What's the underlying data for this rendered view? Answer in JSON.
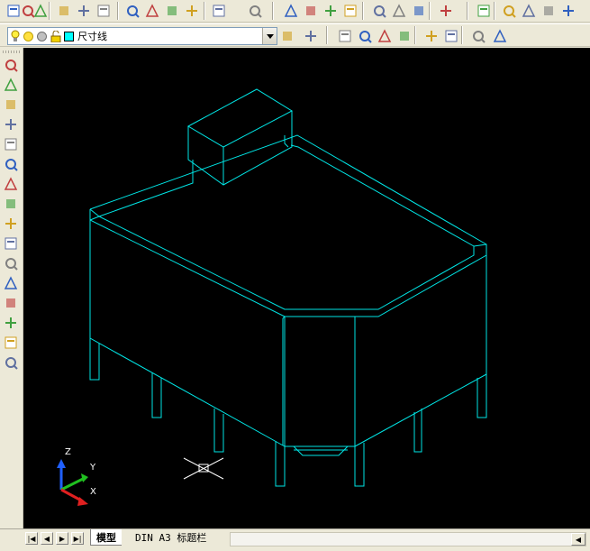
{
  "toolbar": {
    "buttons_row1": [
      {
        "name": "new-icon"
      },
      {
        "name": "open-icon"
      },
      {
        "name": "save-icon"
      },
      {
        "name": "plot-icon"
      },
      {
        "name": "plot-preview-icon"
      },
      {
        "name": "publish-icon"
      },
      {
        "name": "cut-icon"
      },
      {
        "name": "copy-icon"
      },
      {
        "name": "paste-icon"
      },
      {
        "name": "match-properties-icon"
      },
      {
        "name": "undo-icon"
      },
      {
        "name": "redo-icon"
      },
      {
        "name": "pan-icon"
      },
      {
        "name": "zoom-realtime-icon"
      },
      {
        "name": "zoom-window-icon"
      },
      {
        "name": "zoom-previous-icon"
      },
      {
        "name": "properties-icon"
      },
      {
        "name": "design-center-icon"
      },
      {
        "name": "tool-palettes-icon"
      },
      {
        "name": "help-icon"
      },
      {
        "name": "named-views-icon"
      },
      {
        "name": "top-view-icon"
      },
      {
        "name": "front-view-icon"
      },
      {
        "name": "left-view-icon"
      },
      {
        "name": "iso-view-icon"
      }
    ],
    "buttons_row2": [
      {
        "name": "layer-manager-icon"
      },
      {
        "name": "layer-previous-icon"
      },
      {
        "name": "zoom-window-icon"
      },
      {
        "name": "zoom-dynamic-icon"
      },
      {
        "name": "zoom-scale-icon"
      },
      {
        "name": "zoom-center-icon"
      },
      {
        "name": "zoom-in-icon"
      },
      {
        "name": "zoom-out-icon"
      },
      {
        "name": "zoom-all-icon"
      },
      {
        "name": "zoom-extents-icon"
      }
    ]
  },
  "layer": {
    "current": "尺寸线"
  },
  "modify_toolbar": [
    {
      "name": "erase-icon"
    },
    {
      "name": "copy-object-icon"
    },
    {
      "name": "mirror-icon"
    },
    {
      "name": "offset-icon"
    },
    {
      "name": "array-icon"
    },
    {
      "name": "move-icon"
    },
    {
      "name": "rotate-icon"
    },
    {
      "name": "scale-icon"
    },
    {
      "name": "stretch-icon"
    },
    {
      "name": "trim-icon"
    },
    {
      "name": "extend-icon"
    },
    {
      "name": "break-icon"
    },
    {
      "name": "join-icon"
    },
    {
      "name": "chamfer-icon"
    },
    {
      "name": "fillet-icon"
    },
    {
      "name": "explode-icon"
    }
  ],
  "colors": {
    "canvas": "#000000",
    "geometry": "#00e5e5",
    "axis_x": "#e02020",
    "axis_y": "#20c020",
    "axis_z": "#2060ff"
  },
  "ucs": {
    "x_label": "X",
    "y_label": "Y",
    "z_label": "Z"
  },
  "tabs": [
    {
      "label": "模型",
      "active": true
    },
    {
      "label": "DIN A3 标题栏",
      "active": false
    }
  ]
}
